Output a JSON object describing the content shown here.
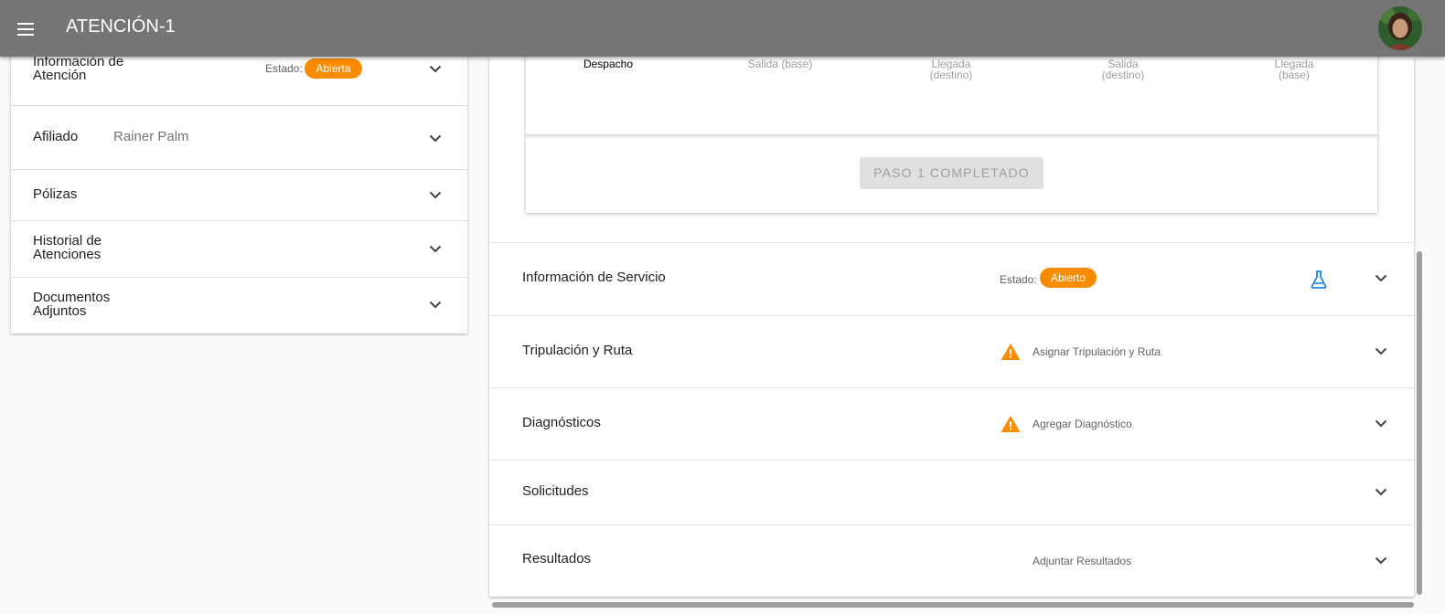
{
  "app": {
    "title": "ATENCIÓN-1"
  },
  "icons": {
    "menu": "menu-icon",
    "avatar": "user-avatar",
    "chevron": "chevron-down-icon",
    "warning": "warning-icon",
    "flask": "flask-icon"
  },
  "colors": {
    "topbar": "#757575",
    "accent_orange": "#fb8c00",
    "flask_blue": "#1e88e5"
  },
  "left_panel": {
    "info": {
      "label": "Información de Atención",
      "estado_label": "Estado:",
      "estado_value": "Abierta"
    },
    "afiliado": {
      "label": "Afiliado",
      "value": "Rainer Palm"
    },
    "polizas": {
      "label": "Pólizas"
    },
    "historial": {
      "label": "Historial de Atenciones"
    },
    "documentos": {
      "label": "Documentos Adjuntos"
    }
  },
  "step_card": {
    "timeline": [
      {
        "label": "Despacho",
        "active": true
      },
      {
        "label": "Salida (base)",
        "active": false
      },
      {
        "label": "Llegada (destino)",
        "active": false
      },
      {
        "label": "Salida (destino)",
        "active": false
      },
      {
        "label": "Llegada (base)",
        "active": false
      }
    ],
    "button_label": "PASO 1 COMPLETADO"
  },
  "sections": {
    "servicio": {
      "label": "Información de Servicio",
      "estado_label": "Estado:",
      "estado_value": "Abierto"
    },
    "tripulacion": {
      "label": "Tripulación y Ruta",
      "hint": "Asignar Tripulación y Ruta"
    },
    "diagnosticos": {
      "label": "Diagnósticos",
      "hint": "Agregar Diagnóstico"
    },
    "solicitudes": {
      "label": "Solicitudes"
    },
    "resultados": {
      "label": "Resultados",
      "hint": "Adjuntar Resultados"
    }
  }
}
